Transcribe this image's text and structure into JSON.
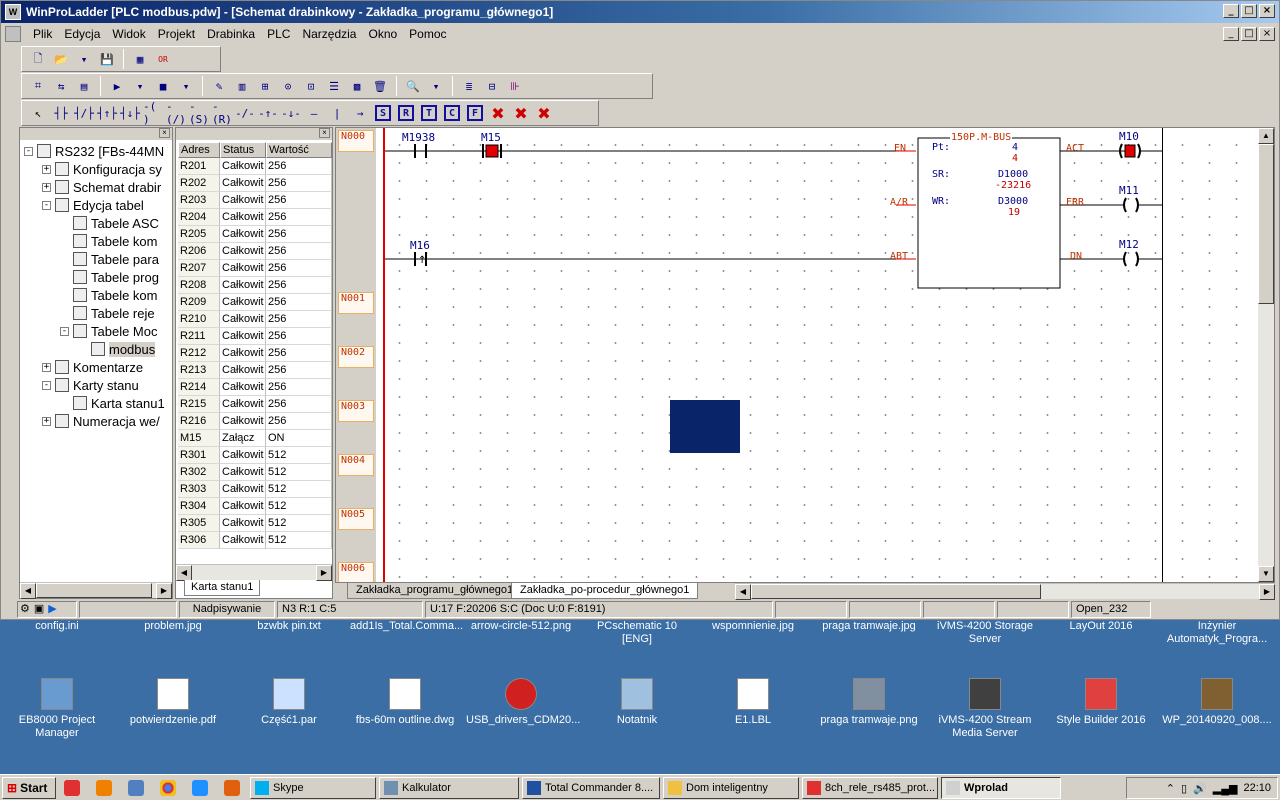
{
  "window": {
    "title": "WinProLadder [PLC modbus.pdw] - [Schemat drabinkowy - Zakładka_programu_głównego1]",
    "buttons": [
      "_",
      "□",
      "×"
    ]
  },
  "menu": [
    "Plik",
    "Edycja",
    "Widok",
    "Projekt",
    "Drabinka",
    "PLC",
    "Narzędzia",
    "Okno",
    "Pomoc"
  ],
  "toolbar3_sq": [
    "S",
    "R",
    "T",
    "C",
    "F"
  ],
  "tree": {
    "root": "RS232 [FBs-44MN",
    "items": [
      {
        "label": "Konfiguracja sy",
        "exp": "+",
        "level": 1
      },
      {
        "label": "Schemat drabir",
        "exp": "+",
        "level": 1
      },
      {
        "label": "Edycja tabel",
        "exp": "-",
        "level": 1
      },
      {
        "label": "Tabele ASC",
        "exp": "",
        "level": 2
      },
      {
        "label": "Tabele kom",
        "exp": "",
        "level": 2
      },
      {
        "label": "Tabele para",
        "exp": "",
        "level": 2
      },
      {
        "label": "Tabele prog",
        "exp": "",
        "level": 2
      },
      {
        "label": "Tabele kom",
        "exp": "",
        "level": 2
      },
      {
        "label": "Tabele reje",
        "exp": "",
        "level": 2
      },
      {
        "label": "Tabele Moc",
        "exp": "-",
        "level": 2
      },
      {
        "label": "modbus",
        "exp": "",
        "level": 3
      },
      {
        "label": "Komentarze",
        "exp": "+",
        "level": 1
      },
      {
        "label": "Karty stanu",
        "exp": "-",
        "level": 1
      },
      {
        "label": "Karta stanu1",
        "exp": "",
        "level": 2
      },
      {
        "label": "Numeracja we/",
        "exp": "+",
        "level": 1
      }
    ]
  },
  "table": {
    "headers": [
      "Adres",
      "Status",
      "Wartość"
    ],
    "rows": [
      [
        "R201",
        "Całkowit",
        "256"
      ],
      [
        "R202",
        "Całkowit",
        "256"
      ],
      [
        "R203",
        "Całkowit",
        "256"
      ],
      [
        "R204",
        "Całkowit",
        "256"
      ],
      [
        "R205",
        "Całkowit",
        "256"
      ],
      [
        "R206",
        "Całkowit",
        "256"
      ],
      [
        "R207",
        "Całkowit",
        "256"
      ],
      [
        "R208",
        "Całkowit",
        "256"
      ],
      [
        "R209",
        "Całkowit",
        "256"
      ],
      [
        "R210",
        "Całkowit",
        "256"
      ],
      [
        "R211",
        "Całkowit",
        "256"
      ],
      [
        "R212",
        "Całkowit",
        "256"
      ],
      [
        "R213",
        "Całkowit",
        "256"
      ],
      [
        "R214",
        "Całkowit",
        "256"
      ],
      [
        "R215",
        "Całkowit",
        "256"
      ],
      [
        "R216",
        "Całkowit",
        "256"
      ],
      [
        "M15",
        "Załącz",
        "ON"
      ],
      [
        "R301",
        "Całkowit",
        "512"
      ],
      [
        "R302",
        "Całkowit",
        "512"
      ],
      [
        "R303",
        "Całkowit",
        "512"
      ],
      [
        "R304",
        "Całkowit",
        "512"
      ],
      [
        "R305",
        "Całkowit",
        "512"
      ],
      [
        "R306",
        "Całkowit",
        "512"
      ]
    ],
    "tab": "Karta stanu1"
  },
  "ladder": {
    "networks": [
      "N000",
      "N001",
      "N002",
      "N003",
      "N004",
      "N005",
      "N006"
    ],
    "contact1": "M1938",
    "contact2": "M15",
    "contact3": "M16",
    "fb_title": "150P.M-BUS",
    "fb_en": "EN",
    "fb_ar": "A/R",
    "fb_abt": "ABT",
    "fb_act": "ACT",
    "fb_err": "ERR",
    "fb_dn": "DN",
    "pt_label": "Pt:",
    "pt_val1": "4",
    "pt_val2": "4",
    "sr_label": "SR:",
    "sr_reg": "D1000",
    "sr_val": "-23216",
    "wr_label": "WR:",
    "wr_reg": "D3000",
    "wr_val": "19",
    "coil1": "M10",
    "coil2": "M11",
    "coil3": "M12"
  },
  "ladder_tabs": [
    "Zakładka_programu_głównego1",
    "Zakładka_po-procedur_głównego1"
  ],
  "status": {
    "mode": "Nadpisywanie",
    "pos": "N3 R:1 C:5",
    "usage": "U:17 F:20206 S:C (Doc U:0 F:8191)",
    "port": "Open_232"
  },
  "desktop_top_labels": [
    "config.ini",
    "problem.jpg",
    "bzwbk pin.txt",
    "add1Is_Total.Comma...",
    "arrow-circle-512.png",
    "PCschematic 10 [ENG]",
    "wspomnienie.jpg",
    "praga tramwaje.jpg",
    "iVMS-4200 Storage Server",
    "LayOut 2016",
    "Inżynier Automatyk_Progra..."
  ],
  "desktop_icons": [
    "EB8000 Project Manager",
    "potwierdzenie.pdf",
    "Część1.par",
    "fbs-60m outline.dwg",
    "USB_drivers_CDM20...",
    "Notatnik",
    "E1.LBL",
    "praga tramwaje.png",
    "iVMS-4200 Stream Media Server",
    "Style Builder 2016",
    "WP_20140920_008...."
  ],
  "taskbar": {
    "start": "Start",
    "tasks": [
      "Skype",
      "Kalkulator",
      "Total Commander 8....",
      "Dom inteligentny",
      "8ch_rele_rs485_prot...",
      "Wprolad"
    ],
    "clock": "22:10"
  }
}
